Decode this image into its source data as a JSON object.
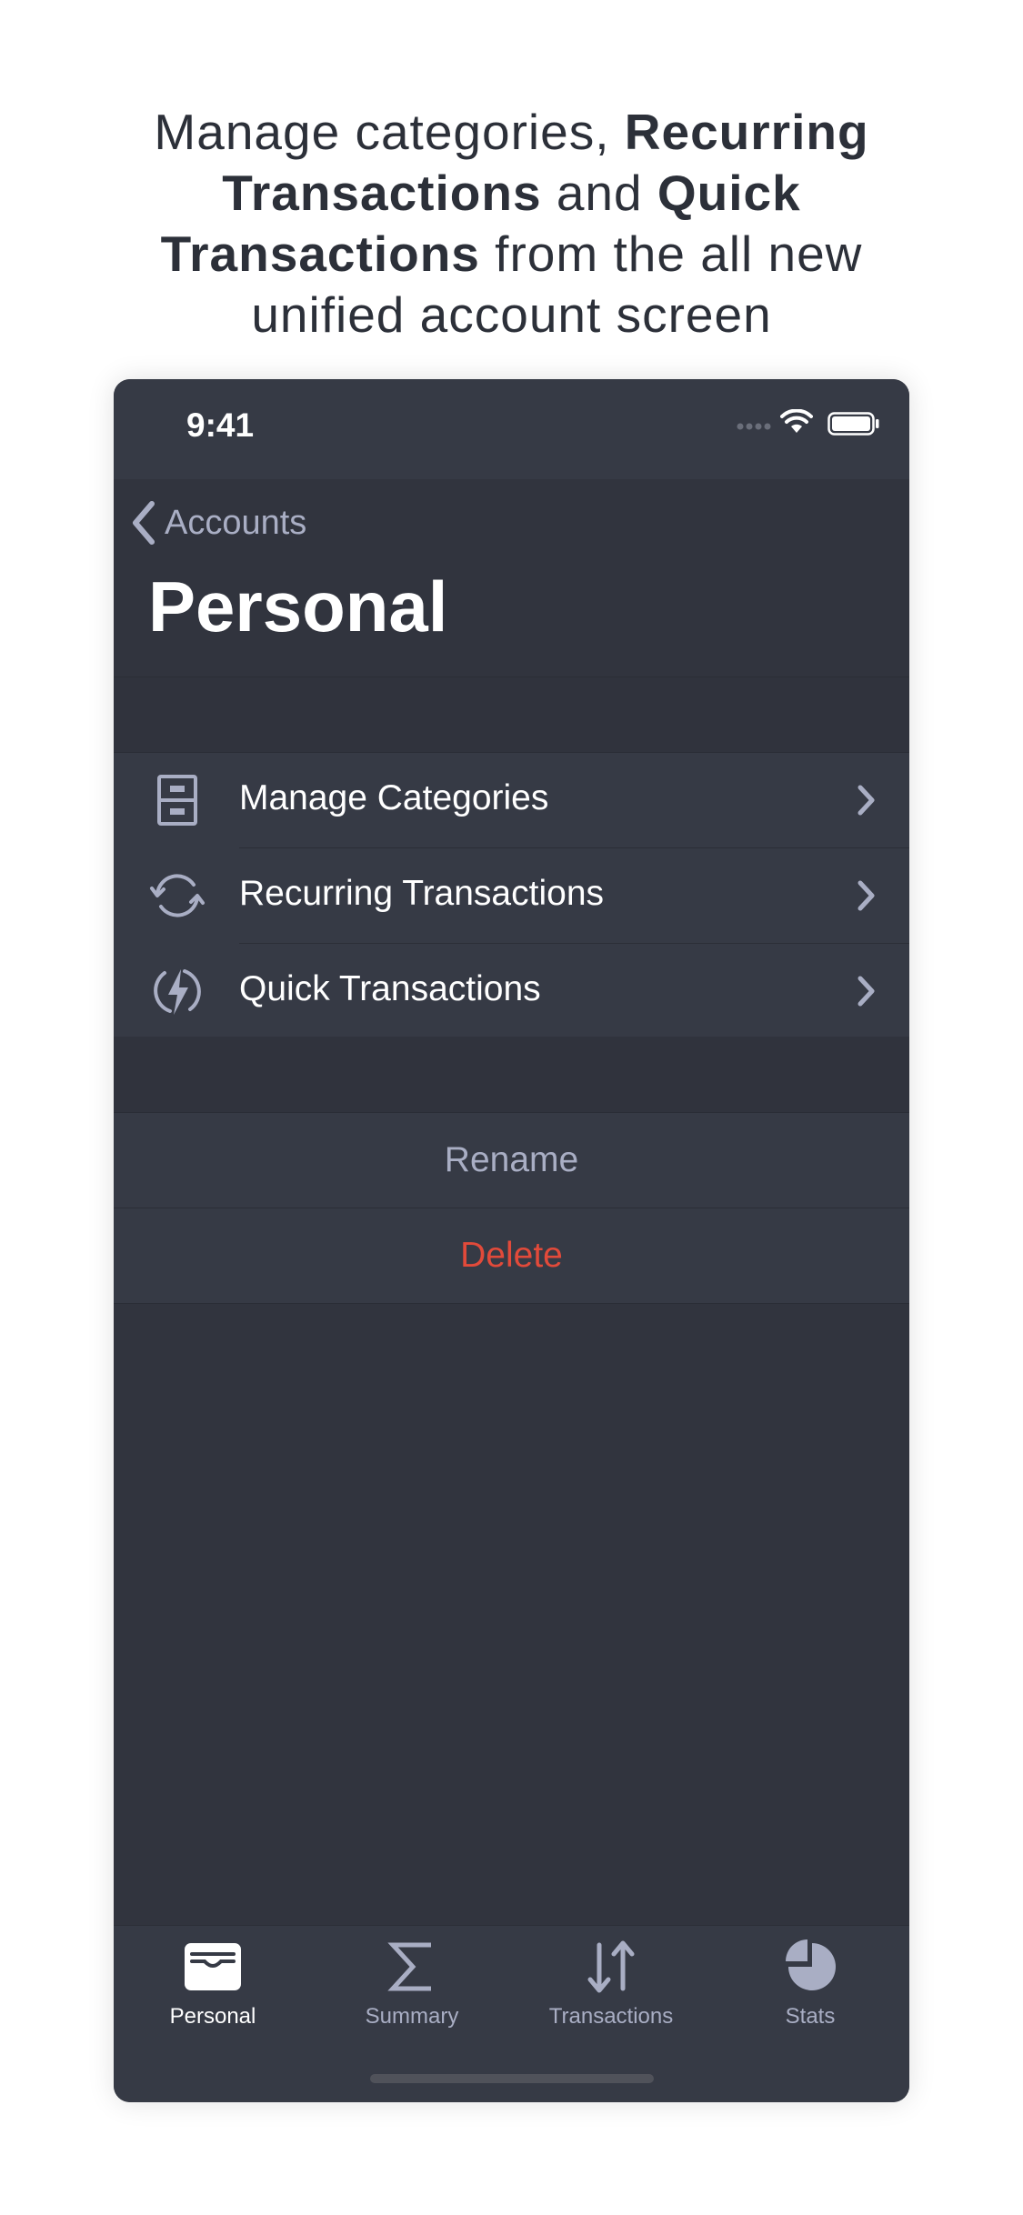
{
  "headline": {
    "line1_prefix": "Manage categories, ",
    "line1_bold": "Recurring",
    "line2_bold": "Transactions",
    "line2_mid": " and ",
    "line2_bold2": "Quick",
    "line3_bold": "Transactions",
    "line3_suffix": " from the all new",
    "line4": "unified account screen"
  },
  "status_bar": {
    "time": "9:41"
  },
  "nav": {
    "back_label": "Accounts",
    "title": "Personal"
  },
  "menu": [
    {
      "label": "Manage Categories",
      "icon": "cabinet-icon"
    },
    {
      "label": "Recurring Transactions",
      "icon": "recurring-icon"
    },
    {
      "label": "Quick Transactions",
      "icon": "lightning-icon"
    }
  ],
  "actions": {
    "rename": "Rename",
    "delete": "Delete"
  },
  "tabs": [
    {
      "label": "Personal",
      "icon": "wallet-icon",
      "active": true
    },
    {
      "label": "Summary",
      "icon": "sigma-icon",
      "active": false
    },
    {
      "label": "Transactions",
      "icon": "arrows-icon",
      "active": false
    },
    {
      "label": "Stats",
      "icon": "pie-chart-icon",
      "active": false
    }
  ],
  "colors": {
    "accent_icon": "#a9aec4",
    "destructive": "#e24a3a",
    "background": "#31343e"
  }
}
